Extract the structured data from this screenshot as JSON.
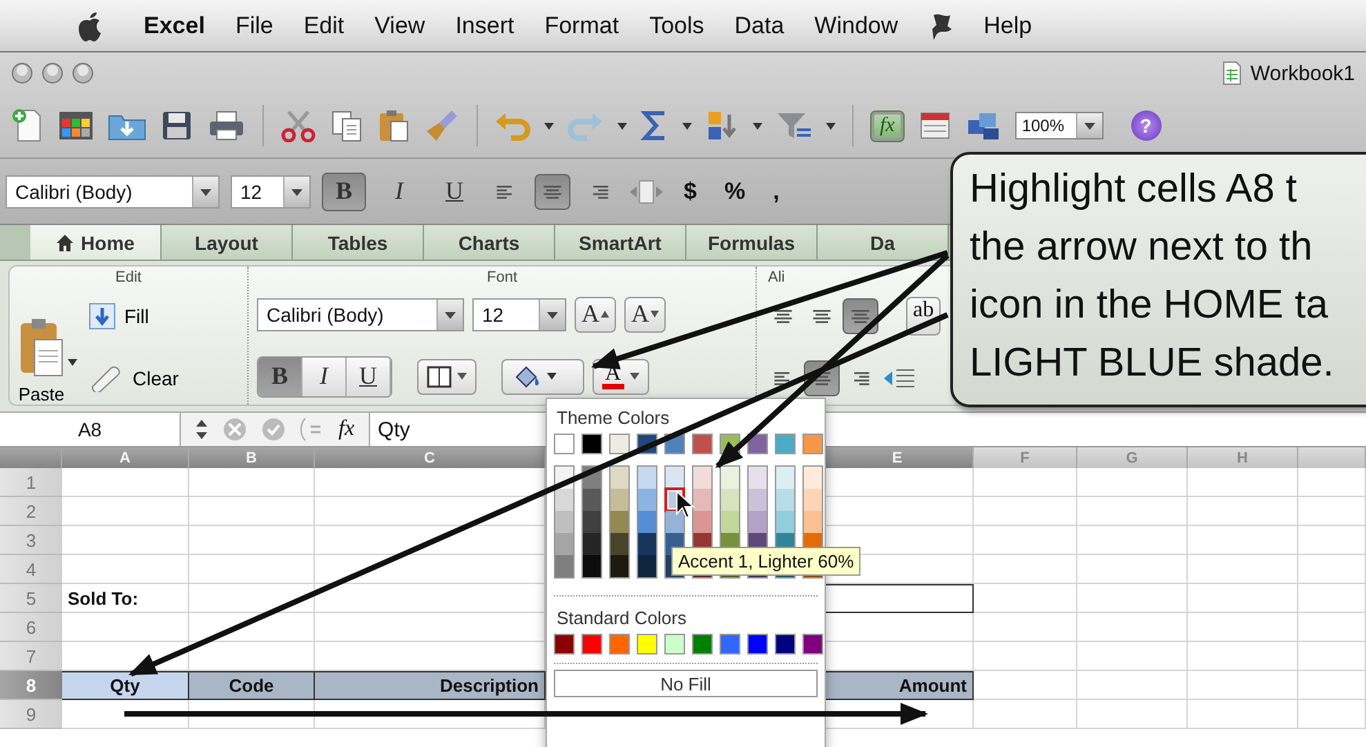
{
  "menu_bar": {
    "app": "Excel",
    "menus": [
      {
        "kind": "menu",
        "label": "File"
      },
      {
        "kind": "menu",
        "label": "Edit"
      },
      {
        "kind": "menu",
        "label": "View"
      },
      {
        "kind": "menu",
        "label": "Insert"
      },
      {
        "kind": "menu",
        "label": "Format"
      },
      {
        "kind": "menu",
        "label": "Tools"
      },
      {
        "kind": "menu",
        "label": "Data"
      },
      {
        "kind": "menu",
        "label": "Window"
      },
      {
        "kind": "script"
      },
      {
        "kind": "menu",
        "label": "Help"
      }
    ]
  },
  "window": {
    "title": "Workbook1"
  },
  "toolbar": {
    "function_label": "fx",
    "zoom": "100%",
    "help_label": "?"
  },
  "format_bar": {
    "font": "Calibri (Body)",
    "size": "12",
    "styles": [
      {
        "label": "B",
        "on": true
      },
      {
        "label": "I",
        "on": false
      },
      {
        "label": "U",
        "on": false
      }
    ],
    "align": [
      {
        "on": false
      },
      {
        "on": true
      },
      {
        "on": false
      }
    ],
    "symbols": [
      "$",
      "%",
      ","
    ]
  },
  "ribbon": {
    "tabs": [
      {
        "label": "Home",
        "selected": true
      },
      {
        "label": "Layout",
        "selected": false
      },
      {
        "label": "Tables",
        "selected": false
      },
      {
        "label": "Charts",
        "selected": false
      },
      {
        "label": "SmartArt",
        "selected": false
      },
      {
        "label": "Formulas",
        "selected": false
      },
      {
        "label": "Da",
        "selected": false
      }
    ],
    "groups": [
      "Edit",
      "Font",
      "Ali"
    ],
    "paste": "Paste",
    "fill": "Fill",
    "clear": "Clear",
    "font": "Calibri (Body)",
    "size": "12",
    "size_buttons": [
      {
        "kind": "grow",
        "label": "A"
      },
      {
        "kind": "shrink",
        "label": "A"
      }
    ],
    "styles": [
      {
        "label": "B",
        "on": true
      },
      {
        "label": "I",
        "on": false
      },
      {
        "label": "U",
        "on": false
      }
    ],
    "font_color_label": "A",
    "align_top": [
      {
        "on": false
      },
      {
        "on": false
      },
      {
        "on": true
      }
    ],
    "align_bottom": [
      {
        "on": false
      },
      {
        "on": true
      },
      {
        "on": false
      }
    ],
    "wrap_label": "ab"
  },
  "formula_bar": {
    "cell": "A8",
    "fx_label": "fx",
    "content": "Qty"
  },
  "sheet": {
    "columns": [
      {
        "label": "A",
        "selected": true
      },
      {
        "label": "B",
        "selected": true
      },
      {
        "label": "C",
        "selected": true
      },
      {},
      {
        "label": "E",
        "selected": true
      },
      {
        "label": "F",
        "selected": false
      },
      {
        "label": "G",
        "selected": false
      },
      {
        "label": "H",
        "selected": false
      },
      {
        "selected": false
      }
    ],
    "rows": [
      {
        "label": "1",
        "selected": false
      },
      {
        "label": "2",
        "selected": false
      },
      {
        "label": "3",
        "selected": false
      },
      {
        "label": "4",
        "selected": false
      },
      {
        "label": "5",
        "selected": false,
        "cells": [
          {
            "kind": "text",
            "text": "Sold To:"
          },
          {},
          {},
          {},
          {
            "kind": "box"
          }
        ]
      },
      {
        "label": "6",
        "selected": false
      },
      {
        "label": "7",
        "selected": false
      },
      {
        "label": "8",
        "selected": true,
        "cells": [
          {
            "kind": "heading",
            "text": "Qty",
            "selected": true
          },
          {
            "kind": "heading",
            "text": "Code",
            "selected": false
          },
          {
            "kind": "heading",
            "text": "Description",
            "selected": false
          },
          {},
          {
            "kind": "heading",
            "text": "Amount",
            "selected": false
          }
        ]
      },
      {
        "label": "9",
        "selected": false
      }
    ]
  },
  "color_menu": {
    "theme_title": "Theme Colors",
    "theme": [
      {
        "color": "#ffffff",
        "shades": [
          {
            "color": "#f2f2f2",
            "selected": false
          },
          {
            "color": "#d8d8d8",
            "selected": false
          },
          {
            "color": "#bfbfbf",
            "selected": false
          },
          {
            "color": "#a5a5a5",
            "selected": false
          },
          {
            "color": "#7f7f7f",
            "selected": false
          }
        ]
      },
      {
        "color": "#000000",
        "shades": [
          {
            "color": "#7f7f7f",
            "selected": false
          },
          {
            "color": "#595959",
            "selected": false
          },
          {
            "color": "#3f3f3f",
            "selected": false
          },
          {
            "color": "#262626",
            "selected": false
          },
          {
            "color": "#0c0c0c",
            "selected": false
          }
        ]
      },
      {
        "color": "#eeece1",
        "shades": [
          {
            "color": "#ddd9c3",
            "selected": false
          },
          {
            "color": "#c4bd97",
            "selected": false
          },
          {
            "color": "#938953",
            "selected": false
          },
          {
            "color": "#494429",
            "selected": false
          },
          {
            "color": "#1d1b10",
            "selected": false
          }
        ]
      },
      {
        "color": "#1f497d",
        "shades": [
          {
            "color": "#c6d9f0",
            "selected": false
          },
          {
            "color": "#8db3e2",
            "selected": false
          },
          {
            "color": "#548dd4",
            "selected": false
          },
          {
            "color": "#17365d",
            "selected": false
          },
          {
            "color": "#0f243e",
            "selected": false
          }
        ]
      },
      {
        "color": "#4f81bd",
        "shades": [
          {
            "color": "#dbe5f1",
            "selected": false
          },
          {
            "color": "#b8cce4",
            "selected": true
          },
          {
            "color": "#95b3d7",
            "selected": false
          },
          {
            "color": "#366092",
            "selected": false
          },
          {
            "color": "#244061",
            "selected": false
          }
        ]
      },
      {
        "color": "#c0504d",
        "shades": [
          {
            "color": "#f2dcdb",
            "selected": false
          },
          {
            "color": "#e5b9b7",
            "selected": false
          },
          {
            "color": "#d99694",
            "selected": false
          },
          {
            "color": "#953734",
            "selected": false
          },
          {
            "color": "#632423",
            "selected": false
          }
        ]
      },
      {
        "color": "#9bbb59",
        "shades": [
          {
            "color": "#ebf1dd",
            "selected": false
          },
          {
            "color": "#d7e3bc",
            "selected": false
          },
          {
            "color": "#c3d69b",
            "selected": false
          },
          {
            "color": "#76923c",
            "selected": false
          },
          {
            "color": "#4f6128",
            "selected": false
          }
        ]
      },
      {
        "color": "#8064a2",
        "shades": [
          {
            "color": "#e5e0ec",
            "selected": false
          },
          {
            "color": "#ccc1d9",
            "selected": false
          },
          {
            "color": "#b2a2c7",
            "selected": false
          },
          {
            "color": "#5f497a",
            "selected": false
          },
          {
            "color": "#3f3151",
            "selected": false
          }
        ]
      },
      {
        "color": "#4bacc6",
        "shades": [
          {
            "color": "#dbeef3",
            "selected": false
          },
          {
            "color": "#b7dde8",
            "selected": false
          },
          {
            "color": "#92cddc",
            "selected": false
          },
          {
            "color": "#31859b",
            "selected": false
          },
          {
            "color": "#205867",
            "selected": false
          }
        ]
      },
      {
        "color": "#f79646",
        "shades": [
          {
            "color": "#fdeada",
            "selected": false
          },
          {
            "color": "#fbd5b5",
            "selected": false
          },
          {
            "color": "#fac08f",
            "selected": false
          },
          {
            "color": "#e36c09",
            "selected": false
          },
          {
            "color": "#974806",
            "selected": false
          }
        ]
      }
    ],
    "tooltip": "Accent 1, Lighter 60%",
    "standard_title": "Standard Colors",
    "standard": [
      {
        "color": "#8b0000"
      },
      {
        "color": "#ff0000"
      },
      {
        "color": "#ff6600"
      },
      {
        "color": "#ffff00"
      },
      {
        "color": "#ccffcc"
      },
      {
        "color": "#008000"
      },
      {
        "color": "#3366ff"
      },
      {
        "color": "#0000ff"
      },
      {
        "color": "#000080"
      },
      {
        "color": "#800080"
      }
    ],
    "no_fill": "No Fill"
  },
  "callout": {
    "lines": [
      "Highlight cells A8 t",
      "the arrow next to th",
      "icon in the HOME ta",
      "LIGHT BLUE shade."
    ]
  }
}
